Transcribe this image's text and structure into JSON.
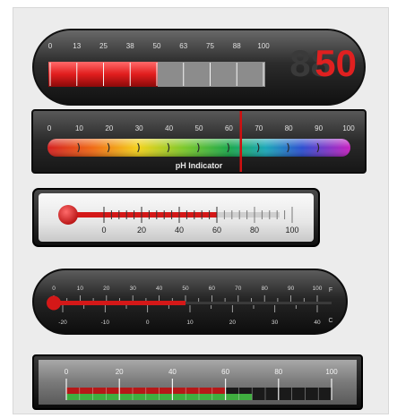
{
  "gauges": {
    "g1": {
      "scale_labels": [
        "0",
        "13",
        "25",
        "38",
        "50",
        "63",
        "75",
        "88",
        "100"
      ],
      "value": 50,
      "digital_readout": "50",
      "fill_color": "#e11d1d",
      "readout_color": "#e02020"
    },
    "g2": {
      "scale_labels": [
        "0",
        "10",
        "20",
        "30",
        "40",
        "50",
        "60",
        "70",
        "80",
        "90",
        "100"
      ],
      "marker_value": 64,
      "caption": "pH Indicator",
      "marker_color": "#d01010"
    },
    "g3": {
      "scale_labels": [
        "0",
        "20",
        "40",
        "60",
        "80",
        "100"
      ],
      "value": 60,
      "fill_color": "#d41818"
    },
    "g4": {
      "top_labels": [
        "0",
        "10",
        "20",
        "30",
        "40",
        "50",
        "60",
        "70",
        "80",
        "90",
        "100"
      ],
      "top_unit": "F",
      "bottom_labels": [
        "-20",
        "-10",
        "0",
        "10",
        "20",
        "30",
        "40"
      ],
      "bottom_unit": "C",
      "value": 50,
      "fill_color": "#d41818"
    },
    "g5": {
      "scale_labels": [
        "0",
        "20",
        "40",
        "60",
        "80",
        "100"
      ],
      "red_value": 60,
      "green_value": 70,
      "red_color": "#b51818",
      "green_color": "#3fae3f"
    }
  }
}
